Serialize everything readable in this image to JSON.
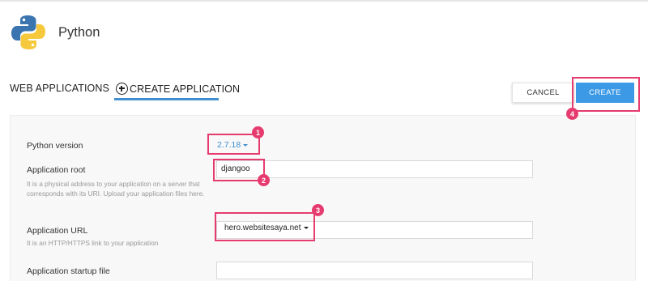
{
  "app": {
    "title": "Python",
    "logo_icon": "python-logo-icon"
  },
  "tabs": [
    {
      "label": "WEB APPLICATIONS",
      "active": false
    },
    {
      "label": "CREATE APPLICATION",
      "active": true,
      "icon": "plus-circle-icon"
    }
  ],
  "actions": {
    "cancel_label": "CANCEL",
    "create_label": "CREATE"
  },
  "form": {
    "python_version": {
      "label": "Python version",
      "value": "2.7.18"
    },
    "app_root": {
      "label": "Application root",
      "value": "djangoo",
      "hint": "It is a physical address to your application on a server that corresponds with its URI. Upload your application files here."
    },
    "app_url": {
      "label": "Application URL",
      "domain": "hero.websitesaya.net",
      "path": "",
      "hint": "It is an HTTP/HTTPS link to your application"
    },
    "startup_file": {
      "label": "Application startup file",
      "value": ""
    }
  },
  "annotations": [
    "1",
    "2",
    "3",
    "4"
  ],
  "colors": {
    "accent": "#3c99e6",
    "link": "#3c8ed0",
    "highlight": "#e63b6f",
    "panel_bg": "#f8f8f8"
  }
}
